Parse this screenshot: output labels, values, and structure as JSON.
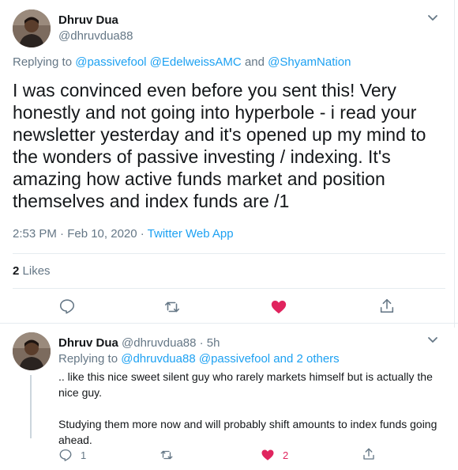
{
  "main_tweet": {
    "author_name": "Dhruv Dua",
    "author_handle": "@dhruvdua88",
    "replying_prefix": "Replying to",
    "replying_mention_1": "@passivefool",
    "replying_mention_2": "@EdelweissAMC",
    "replying_and": "and",
    "replying_mention_3": "@ShyamNation",
    "text": "I was convinced even before you sent this! Very honestly and not going into hyperbole - i read your newsletter yesterday and it's opened up my mind to the wonders of passive investing / indexing. It's amazing how active funds market and position themselves and index funds are /1",
    "time": "2:53 PM · Feb 10, 2020 ·",
    "app": "Twitter Web App",
    "likes_count": "2",
    "likes_label": "Likes"
  },
  "reply_tweet": {
    "author_name": "Dhruv Dua",
    "author_handle": "@dhruvdua88 · 5h",
    "replying_prefix": "Replying to",
    "replying_mentions": "@dhruvdua88 @passivefool and 2 others",
    "paragraph_1": ".. like this nice sweet silent guy who rarely markets himself but is actually the nice guy.",
    "paragraph_2": "Studying them more now and will probably shift amounts to index funds going ahead.",
    "reply_count": "1",
    "like_count": "2"
  },
  "icons": {
    "reply": "reply-icon",
    "retweet": "retweet-icon",
    "like": "heart-icon",
    "share": "share-icon",
    "more": "chevron-down-icon"
  },
  "colors": {
    "accent": "#1da1f2",
    "like": "#e0245e",
    "secondary_text": "#657786",
    "primary_text": "#14171a"
  }
}
